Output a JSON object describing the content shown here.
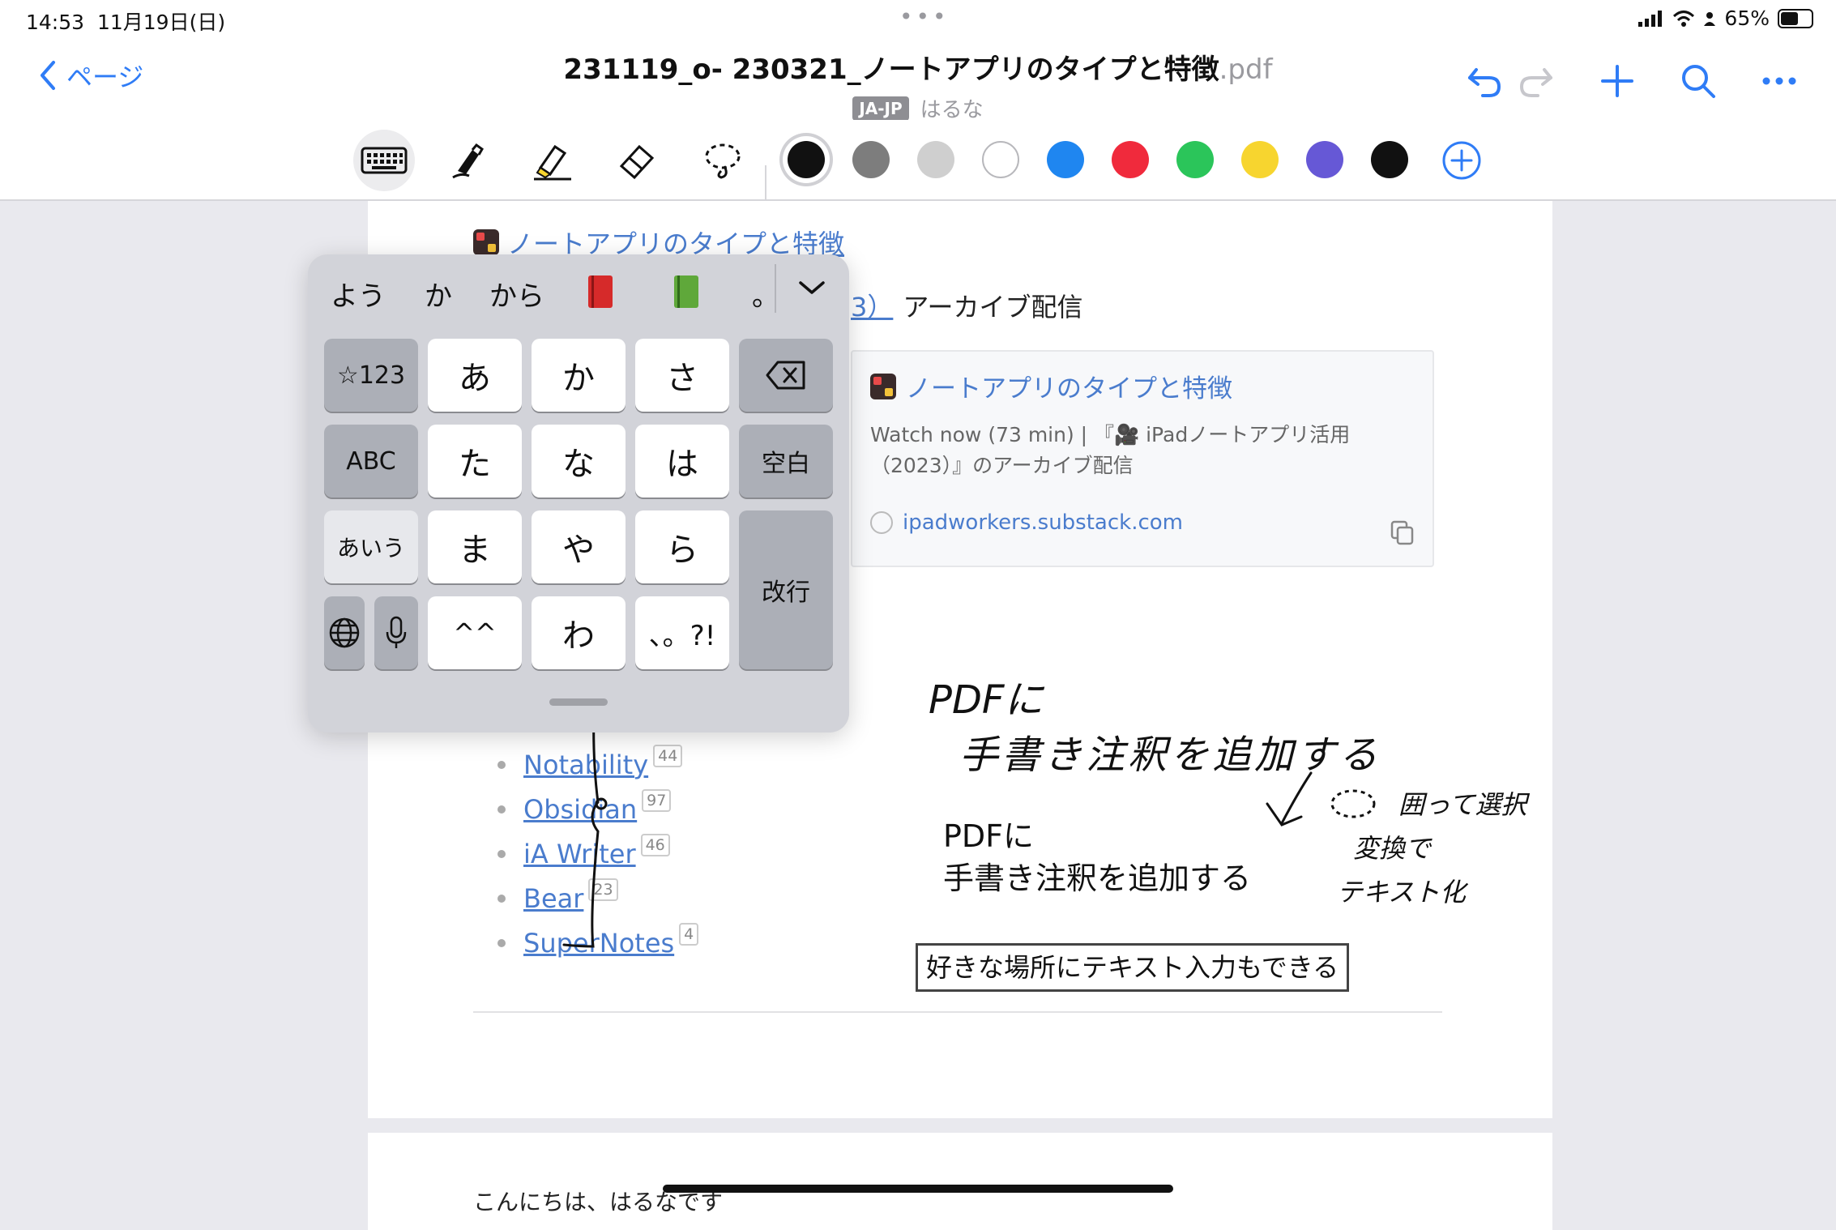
{
  "status_bar": {
    "time": "14:53",
    "date": "11月19日(日)",
    "battery_text": "65%",
    "battery_level": 0.65
  },
  "nav": {
    "back_label": "ページ",
    "title": "231119_o- 230321_ノートアプリのタイプと特徴",
    "title_ext": ".pdf",
    "lang_badge": "JA-JP",
    "author": "はるな",
    "icons": [
      "undo-icon",
      "redo-icon",
      "plus-icon",
      "search-icon",
      "more-icon"
    ]
  },
  "toolbar": {
    "tools": [
      "keyboard-icon",
      "pen-icon",
      "highlighter-icon",
      "eraser-icon",
      "lasso-icon"
    ],
    "colors": [
      "#111111",
      "#7d7d7d",
      "#cfcfcf",
      "#ffffff",
      "#1f86f0",
      "#f02a3c",
      "#2bc55a",
      "#f7d52f",
      "#6658d6",
      "#111111"
    ],
    "selected_color_index": 0,
    "add_icon": "add-color-icon"
  },
  "document": {
    "top_link_text": "ノートアプリのタイプと特徴",
    "archive_link_fragment": "3）",
    "archive_text": "アーカイブ配信",
    "card": {
      "title": "ノートアプリのタイプと特徴",
      "description": "Watch now (73 min) | 『🎥 iPadノートアプリ活用（2023）』のアーカイブ配信",
      "url": "ipadworkers.substack.com"
    },
    "apps": [
      {
        "name": "Notability",
        "count": "44"
      },
      {
        "name": "Obsidian",
        "count": "97"
      },
      {
        "name": "iA Writer",
        "count": "46"
      },
      {
        "name": "Bear",
        "count": "23"
      },
      {
        "name": "SuperNotes",
        "count": "4"
      }
    ],
    "typed_line1": "PDFに",
    "typed_line2": "手書き注釈を追加する",
    "text_box": "好きな場所にテキスト入力もできる",
    "handwriting": {
      "line1": "PDFに",
      "line2": "手書き注釈を追加する",
      "note1": "囲って選択",
      "note2": "変換で",
      "note3": "テキスト化"
    },
    "next_page_text": "こんにちは、はるなです"
  },
  "keyboard": {
    "candidates": [
      "よう",
      "か",
      "から",
      "📕",
      "📗",
      "。"
    ],
    "row1": [
      "☆123",
      "あ",
      "か",
      "さ"
    ],
    "row2": [
      "ABC",
      "た",
      "な",
      "は",
      "空白"
    ],
    "row3": [
      "あいう",
      "ま",
      "や",
      "ら",
      "改行"
    ],
    "row4": [
      "^^",
      "わ",
      "、。?!"
    ]
  }
}
